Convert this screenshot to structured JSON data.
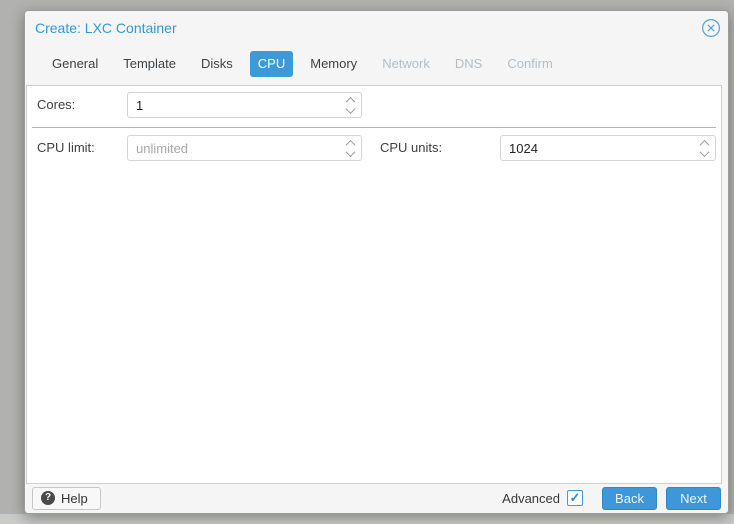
{
  "dialog": {
    "title": "Create: LXC Container",
    "tabs": [
      {
        "label": "General",
        "state": "enabled"
      },
      {
        "label": "Template",
        "state": "enabled"
      },
      {
        "label": "Disks",
        "state": "enabled"
      },
      {
        "label": "CPU",
        "state": "active"
      },
      {
        "label": "Memory",
        "state": "enabled"
      },
      {
        "label": "Network",
        "state": "disabled"
      },
      {
        "label": "DNS",
        "state": "disabled"
      },
      {
        "label": "Confirm",
        "state": "disabled"
      }
    ],
    "fields": {
      "cores": {
        "label": "Cores:",
        "value": "1",
        "placeholder": ""
      },
      "cpu_limit": {
        "label": "CPU limit:",
        "value": "",
        "placeholder": "unlimited"
      },
      "cpu_units": {
        "label": "CPU units:",
        "value": "1024",
        "placeholder": ""
      }
    },
    "footer": {
      "help_label": "Help",
      "help_icon_glyph": "?",
      "advanced_label": "Advanced",
      "advanced_checked": true,
      "back_label": "Back",
      "next_label": "Next"
    },
    "colors": {
      "accent": "#3d9ad8",
      "title": "#2e9ada",
      "disabled_tab": "#b8bdc2"
    }
  }
}
